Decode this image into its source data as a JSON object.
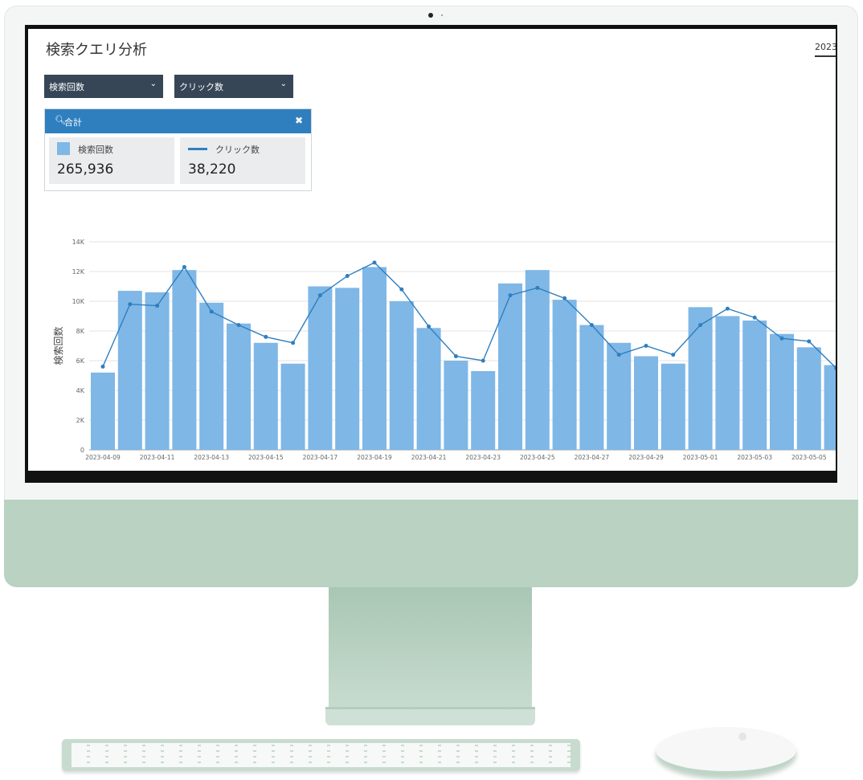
{
  "app": {
    "title": "検索クエリ分析",
    "date_tab": "2023"
  },
  "dropdowns": [
    {
      "label": "検索回数",
      "chevron": "⌄"
    },
    {
      "label": "クリック数",
      "chevron": "⌄"
    }
  ],
  "panel": {
    "title": "合計",
    "search_glyph": "🔍︎",
    "close_glyph": "✖",
    "kpis": [
      {
        "label": "検索回数",
        "value": "265,936"
      },
      {
        "label": "クリック数",
        "value": "38,220"
      }
    ]
  },
  "colors": {
    "bar": "#7fb7e6",
    "line": "#2f7fbf",
    "header": "#2f7fbf",
    "dropdown": "#364656"
  },
  "chart_data": {
    "type": "bar",
    "ylabel": "検索回数",
    "ylim": [
      0,
      14000
    ],
    "yticks": [
      "0",
      "2K",
      "4K",
      "6K",
      "8K",
      "10K",
      "12K",
      "14K"
    ],
    "grid": true,
    "xtick_labels": [
      "2023-04-09",
      "2023-04-11",
      "2023-04-13",
      "2023-04-15",
      "2023-04-17",
      "2023-04-19",
      "2023-04-21",
      "2023-04-23",
      "2023-04-25",
      "2023-04-27",
      "2023-04-29",
      "2023-05-01",
      "2023-05-03",
      "2023-05-05"
    ],
    "categories": [
      "2023-04-09",
      "2023-04-10",
      "2023-04-11",
      "2023-04-12",
      "2023-04-13",
      "2023-04-14",
      "2023-04-15",
      "2023-04-16",
      "2023-04-17",
      "2023-04-18",
      "2023-04-19",
      "2023-04-20",
      "2023-04-21",
      "2023-04-22",
      "2023-04-23",
      "2023-04-24",
      "2023-04-25",
      "2023-04-26",
      "2023-04-27",
      "2023-04-28",
      "2023-04-29",
      "2023-04-30",
      "2023-05-01",
      "2023-05-02",
      "2023-05-03",
      "2023-05-04",
      "2023-05-05",
      "2023-05-06"
    ],
    "series": [
      {
        "name": "検索回数",
        "type": "bar",
        "values": [
          5200,
          10700,
          10600,
          12100,
          9900,
          8500,
          7200,
          5800,
          11000,
          10900,
          12300,
          10000,
          8200,
          6000,
          5300,
          11200,
          12100,
          10100,
          8400,
          7200,
          6300,
          5800,
          9600,
          9000,
          8700,
          7800,
          6900,
          5700
        ]
      },
      {
        "name": "クリック数",
        "type": "line",
        "values": [
          5600,
          9800,
          9700,
          12300,
          9300,
          8400,
          7600,
          7200,
          10400,
          11700,
          12600,
          10800,
          8300,
          6300,
          6000,
          10400,
          10900,
          10200,
          8400,
          6400,
          7000,
          6400,
          8400,
          9500,
          8900,
          7500,
          7300,
          5500
        ]
      }
    ]
  }
}
